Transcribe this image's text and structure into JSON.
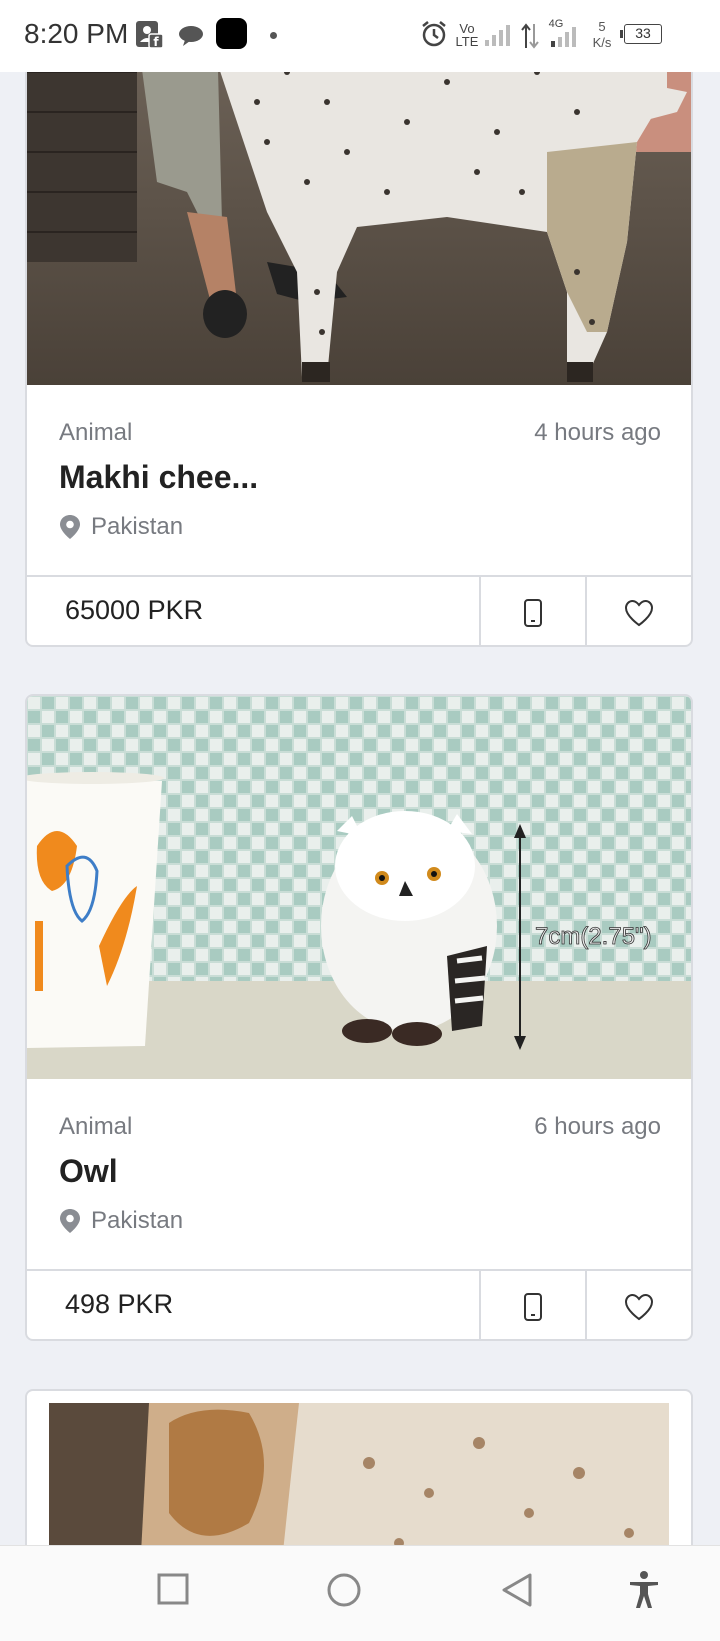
{
  "status_bar": {
    "time": "8:20 PM",
    "network": "Vo LTE",
    "net_type": "4G",
    "speed_value": "5",
    "speed_unit": "K/s",
    "battery": "33"
  },
  "listings": [
    {
      "category": "Animal",
      "time_ago": "4 hours ago",
      "title": "Makhi chee...",
      "location": "Pakistan",
      "price": "65000 PKR",
      "image": "spotted-goat-photo"
    },
    {
      "category": "Animal",
      "time_ago": "6 hours ago",
      "title": "Owl",
      "location": "Pakistan",
      "price": "498 PKR",
      "image": "white-owl-figurine-photo",
      "image_overlay_text": "7cm(2.75\")"
    },
    {
      "image": "brown-white-goat-photo"
    }
  ],
  "icons": {
    "location": "location-pin-icon",
    "phone": "phone-icon",
    "favorite": "heart-icon"
  },
  "colors": {
    "background": "#eef0f5",
    "card_border": "#d9dbe0",
    "muted_text": "#777a80"
  }
}
